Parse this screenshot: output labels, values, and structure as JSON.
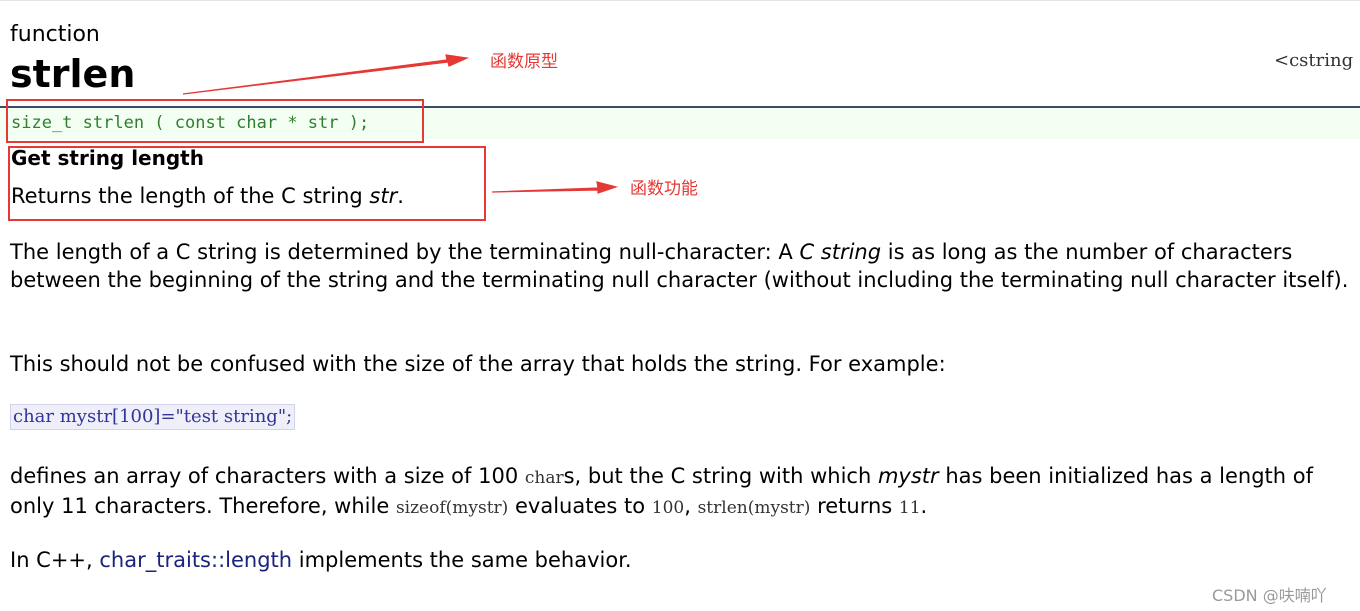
{
  "header": {
    "kind": "function",
    "title": "strlen",
    "header_link": "<cstring"
  },
  "prototype": {
    "code": "size_t strlen ( const char * str );"
  },
  "summary": {
    "heading": "Get string length",
    "desc_prefix": "Returns the length of the C string ",
    "desc_param": "str",
    "desc_suffix": "."
  },
  "body": {
    "p1_a": "The length of a C string is determined by the terminating null-character: A ",
    "p1_em": "C string",
    "p1_b": " is as long as the number of characters between the beginning of the string and the terminating null character (without including the terminating null character itself).",
    "p2": "This should not be confused with the size of the array that holds the string. For example:",
    "example_code": "char mystr[100]=\"test string\";",
    "p3_a": "defines an array of characters with a size of 100 ",
    "p3_code1": "char",
    "p3_b": "s, but the C string with which ",
    "p3_em": "mystr",
    "p3_c": " has been initialized has a length of only 11 characters. Therefore, while ",
    "p3_code2": "sizeof(mystr)",
    "p3_d": " evaluates to ",
    "p3_code3": "100",
    "p3_e": ", ",
    "p3_code4": "strlen(mystr)",
    "p3_f": " returns ",
    "p3_code5": "11",
    "p3_g": ".",
    "p4_a": "In C++, ",
    "p4_link": "char_traits::length",
    "p4_b": " implements the same behavior."
  },
  "annotations": {
    "prototype_label": "函数原型",
    "function_label": "函数功能",
    "color": "#e53935"
  },
  "watermark": "CSDN @呋喃吖"
}
